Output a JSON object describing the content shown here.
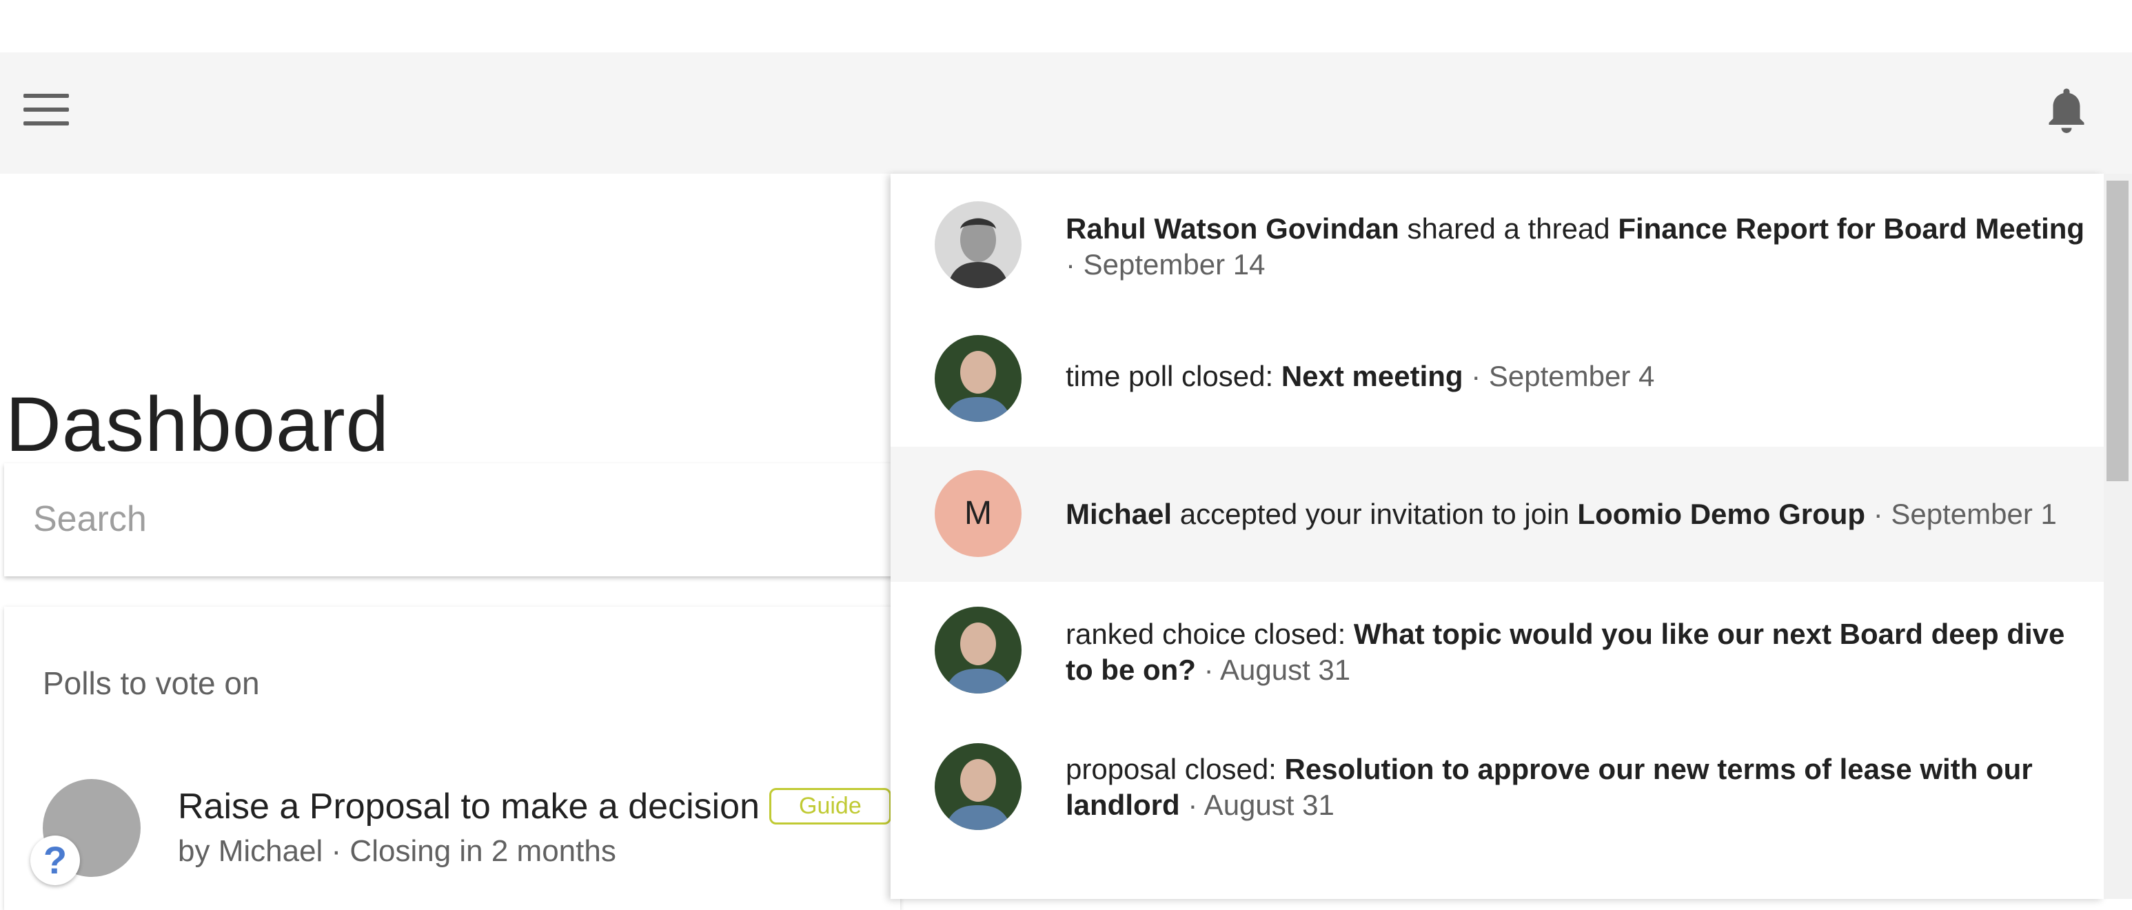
{
  "header": {
    "menu_icon": "hamburger-menu-icon",
    "notifications_icon": "bell-icon"
  },
  "main": {
    "title": "Dashboard",
    "search": {
      "placeholder": "Search",
      "value": ""
    },
    "polls": {
      "heading": "Polls to vote on",
      "items": [
        {
          "title": "Raise a Proposal to make a decision",
          "badge": "Guide",
          "author": "by Michael",
          "closing": "· Closing in 2 months"
        }
      ]
    },
    "help_button": "?"
  },
  "notifications": [
    {
      "actor": "Rahul Watson Govindan",
      "action": " shared a thread ",
      "subject": "Finance Report for Board Meeting",
      "date": " · September 14",
      "avatar": "photo-rahul"
    },
    {
      "actor": "",
      "action": "time poll closed: ",
      "subject": "Next meeting",
      "date": " · September 4",
      "avatar": "photo-michael"
    },
    {
      "actor": "Michael",
      "action": " accepted your invitation to join ",
      "subject": "Loomio Demo Group",
      "date": " · September 1",
      "avatar": "M",
      "highlighted": true
    },
    {
      "actor": "",
      "action": "ranked choice closed: ",
      "subject": "What topic would you like our next Board deep dive to be on?",
      "date": " · August 31",
      "avatar": "photo-michael"
    },
    {
      "actor": "",
      "action": "proposal closed: ",
      "subject": "Resolution to approve our new terms of lease with our landlord",
      "date": " · August 31",
      "avatar": "photo-michael"
    }
  ],
  "colors": {
    "accent_guide": "#c0ca33",
    "avatar_initial_bg": "#eeb2a0",
    "topbar_bg": "#f5f5f5"
  }
}
